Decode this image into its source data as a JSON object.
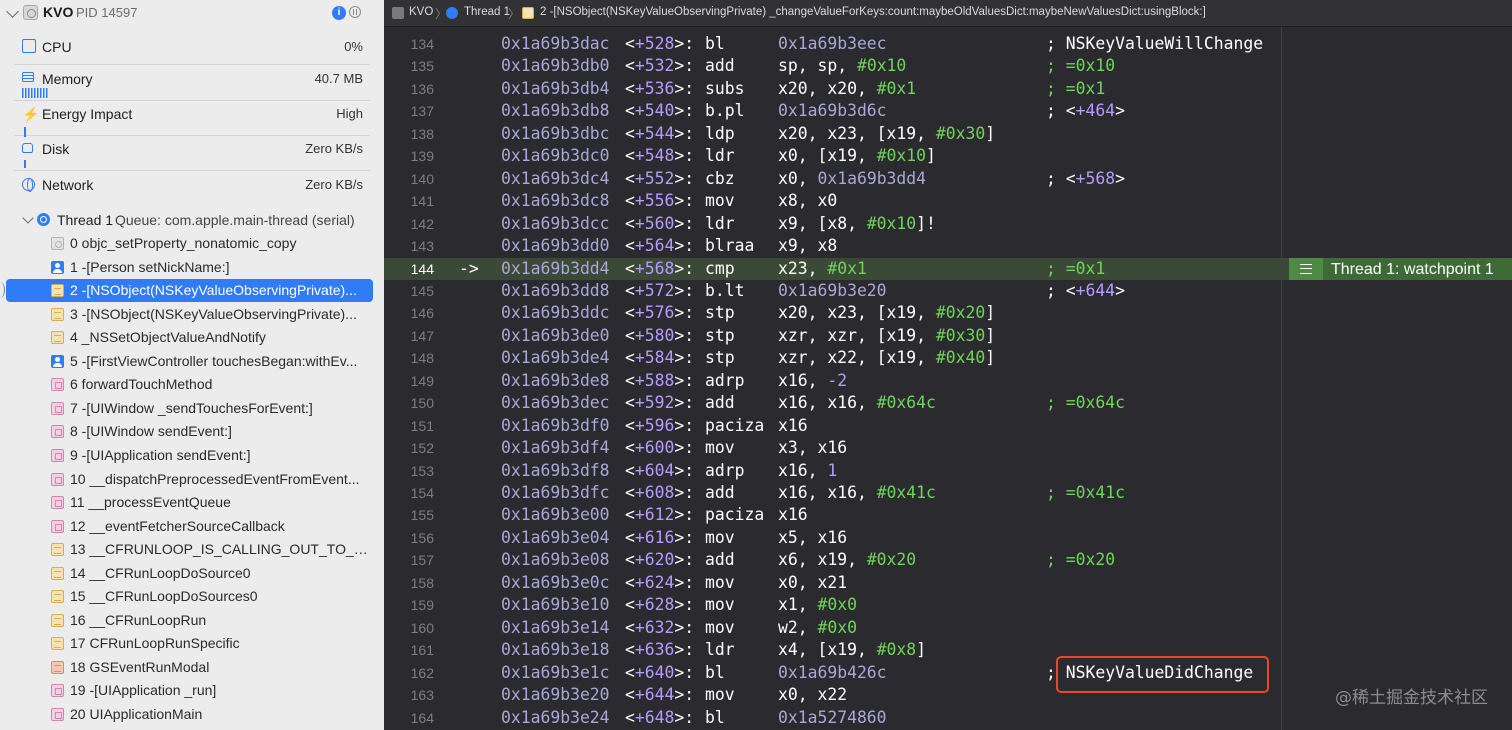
{
  "process": {
    "name": "KVO",
    "pid": "PID 14597"
  },
  "gauges": [
    {
      "label": "CPU",
      "value": "0%",
      "icon": "cpu-icon"
    },
    {
      "label": "Memory",
      "value": "40.7 MB",
      "icon": "memory-icon"
    },
    {
      "label": "Energy Impact",
      "value": "High",
      "icon": "bolt-icon"
    },
    {
      "label": "Disk",
      "value": "Zero KB/s",
      "icon": "disk-icon"
    },
    {
      "label": "Network",
      "value": "Zero KB/s",
      "icon": "globe-icon"
    }
  ],
  "thread": {
    "name": "Thread 1",
    "queue": "Queue: com.apple.main-thread (serial)"
  },
  "frames": [
    {
      "label": "0 objc_setProperty_nonatomic_copy",
      "icon": "gray"
    },
    {
      "label": "1 -[Person setNickName:]",
      "icon": "user"
    },
    {
      "label": "2 -[NSObject(NSKeyValueObservingPrivate)...",
      "icon": "lib",
      "selected": true
    },
    {
      "label": "3 -[NSObject(NSKeyValueObservingPrivate)...",
      "icon": "lib"
    },
    {
      "label": "4 _NSSetObjectValueAndNotify",
      "icon": "lib"
    },
    {
      "label": "5 -[FirstViewController touchesBegan:withEv...",
      "icon": "user"
    },
    {
      "label": "6 forwardTouchMethod",
      "icon": "uikit"
    },
    {
      "label": "7 -[UIWindow _sendTouchesForEvent:]",
      "icon": "uikit"
    },
    {
      "label": "8 -[UIWindow sendEvent:]",
      "icon": "uikit"
    },
    {
      "label": "9 -[UIApplication sendEvent:]",
      "icon": "uikit"
    },
    {
      "label": "10 __dispatchPreprocessedEventFromEvent...",
      "icon": "uikit"
    },
    {
      "label": "11 __processEventQueue",
      "icon": "uikit"
    },
    {
      "label": "12 __eventFetcherSourceCallback",
      "icon": "uikit"
    },
    {
      "label": "13 __CFRUNLOOP_IS_CALLING_OUT_TO_A_...",
      "icon": "lib"
    },
    {
      "label": "14 __CFRunLoopDoSource0",
      "icon": "lib"
    },
    {
      "label": "15 __CFRunLoopDoSources0",
      "icon": "lib"
    },
    {
      "label": "16 __CFRunLoopRun",
      "icon": "lib"
    },
    {
      "label": "17 CFRunLoopRunSpecific",
      "icon": "lib"
    },
    {
      "label": "18 GSEventRunModal",
      "icon": "gs"
    },
    {
      "label": "19 -[UIApplication _run]",
      "icon": "uikit"
    },
    {
      "label": "20 UIApplicationMain",
      "icon": "uikit"
    }
  ],
  "jumpbar": {
    "project": "KVO",
    "thread": "Thread 1",
    "frame": "2 -[NSObject(NSKeyValueObservingPrivate) _changeValueForKeys:count:maybeOldValuesDict:maybeNewValuesDict:usingBlock:]"
  },
  "disassembly": [
    {
      "ln": "134",
      "addr": "0x1a69b3dac",
      "off": "528",
      "mn": "bl",
      "ops": [
        [
          "hexaddr",
          "0x1a69b3eec"
        ]
      ],
      "cmt": "; NSKeyValueWillChange",
      "cmt_style": "white"
    },
    {
      "ln": "135",
      "addr": "0x1a69b3db0",
      "off": "532",
      "mn": "add",
      "ops": [
        [
          "",
          "sp, sp, "
        ],
        [
          "num",
          "#0x10"
        ]
      ],
      "cmt": "; =0x10"
    },
    {
      "ln": "136",
      "addr": "0x1a69b3db4",
      "off": "536",
      "mn": "subs",
      "ops": [
        [
          "",
          "x20, x20, "
        ],
        [
          "num",
          "#0x1"
        ]
      ],
      "cmt": "; =0x1"
    },
    {
      "ln": "137",
      "addr": "0x1a69b3db8",
      "off": "540",
      "mn": "b.pl",
      "ops": [
        [
          "hexaddr",
          "0x1a69b3d6c"
        ]
      ],
      "cmt": "; <+464>",
      "cmt_style": "white"
    },
    {
      "ln": "138",
      "addr": "0x1a69b3dbc",
      "off": "544",
      "mn": "ldp",
      "ops": [
        [
          "",
          "x20, x23, [x19, "
        ],
        [
          "num",
          "#0x30"
        ],
        [
          "",
          "]"
        ]
      ]
    },
    {
      "ln": "139",
      "addr": "0x1a69b3dc0",
      "off": "548",
      "mn": "ldr",
      "ops": [
        [
          "",
          "x0, [x19, "
        ],
        [
          "num",
          "#0x10"
        ],
        [
          "",
          "]"
        ]
      ]
    },
    {
      "ln": "140",
      "addr": "0x1a69b3dc4",
      "off": "552",
      "mn": "cbz",
      "ops": [
        [
          "",
          "x0, "
        ],
        [
          "hexaddr",
          "0x1a69b3dd4"
        ]
      ],
      "cmt": "; <+568>",
      "cmt_style": "white"
    },
    {
      "ln": "141",
      "addr": "0x1a69b3dc8",
      "off": "556",
      "mn": "mov",
      "ops": [
        [
          "",
          "x8, x0"
        ]
      ]
    },
    {
      "ln": "142",
      "addr": "0x1a69b3dcc",
      "off": "560",
      "mn": "ldr",
      "ops": [
        [
          "",
          "x9, [x8, "
        ],
        [
          "num",
          "#0x10"
        ],
        [
          "",
          "]!"
        ]
      ]
    },
    {
      "ln": "143",
      "addr": "0x1a69b3dd0",
      "off": "564",
      "mn": "blraa",
      "ops": [
        [
          "",
          "x9, x8"
        ]
      ]
    },
    {
      "ln": "144",
      "addr": "0x1a69b3dd4",
      "off": "568",
      "mn": "cmp",
      "ops": [
        [
          "",
          "x23, "
        ],
        [
          "num",
          "#0x1"
        ]
      ],
      "cmt": "; =0x1",
      "current": true,
      "arrow": "->"
    },
    {
      "ln": "145",
      "addr": "0x1a69b3dd8",
      "off": "572",
      "mn": "b.lt",
      "ops": [
        [
          "hexaddr",
          "0x1a69b3e20"
        ]
      ],
      "cmt": "; <+644>",
      "cmt_style": "white"
    },
    {
      "ln": "146",
      "addr": "0x1a69b3ddc",
      "off": "576",
      "mn": "stp",
      "ops": [
        [
          "",
          "x20, x23, [x19, "
        ],
        [
          "num",
          "#0x20"
        ],
        [
          "",
          "]"
        ]
      ]
    },
    {
      "ln": "147",
      "addr": "0x1a69b3de0",
      "off": "580",
      "mn": "stp",
      "ops": [
        [
          "",
          "xzr, xzr, [x19, "
        ],
        [
          "num",
          "#0x30"
        ],
        [
          "",
          "]"
        ]
      ]
    },
    {
      "ln": "148",
      "addr": "0x1a69b3de4",
      "off": "584",
      "mn": "stp",
      "ops": [
        [
          "",
          "xzr, x22, [x19, "
        ],
        [
          "num",
          "#0x40"
        ],
        [
          "",
          "]"
        ]
      ]
    },
    {
      "ln": "149",
      "addr": "0x1a69b3de8",
      "off": "588",
      "mn": "adrp",
      "ops": [
        [
          "",
          "x16, "
        ],
        [
          "neg",
          "-2"
        ]
      ]
    },
    {
      "ln": "150",
      "addr": "0x1a69b3dec",
      "off": "592",
      "mn": "add",
      "ops": [
        [
          "",
          "x16, x16, "
        ],
        [
          "num",
          "#0x64c"
        ]
      ],
      "cmt": "; =0x64c"
    },
    {
      "ln": "151",
      "addr": "0x1a69b3df0",
      "off": "596",
      "mn": "paciza",
      "ops": [
        [
          "",
          "x16"
        ]
      ]
    },
    {
      "ln": "152",
      "addr": "0x1a69b3df4",
      "off": "600",
      "mn": "mov",
      "ops": [
        [
          "",
          "x3, x16"
        ]
      ]
    },
    {
      "ln": "153",
      "addr": "0x1a69b3df8",
      "off": "604",
      "mn": "adrp",
      "ops": [
        [
          "",
          "x16, "
        ],
        [
          "neg",
          "1"
        ]
      ]
    },
    {
      "ln": "154",
      "addr": "0x1a69b3dfc",
      "off": "608",
      "mn": "add",
      "ops": [
        [
          "",
          "x16, x16, "
        ],
        [
          "num",
          "#0x41c"
        ]
      ],
      "cmt": "; =0x41c"
    },
    {
      "ln": "155",
      "addr": "0x1a69b3e00",
      "off": "612",
      "mn": "paciza",
      "ops": [
        [
          "",
          "x16"
        ]
      ]
    },
    {
      "ln": "156",
      "addr": "0x1a69b3e04",
      "off": "616",
      "mn": "mov",
      "ops": [
        [
          "",
          "x5, x16"
        ]
      ]
    },
    {
      "ln": "157",
      "addr": "0x1a69b3e08",
      "off": "620",
      "mn": "add",
      "ops": [
        [
          "",
          "x6, x19, "
        ],
        [
          "num",
          "#0x20"
        ]
      ],
      "cmt": "; =0x20"
    },
    {
      "ln": "158",
      "addr": "0x1a69b3e0c",
      "off": "624",
      "mn": "mov",
      "ops": [
        [
          "",
          "x0, x21"
        ]
      ]
    },
    {
      "ln": "159",
      "addr": "0x1a69b3e10",
      "off": "628",
      "mn": "mov",
      "ops": [
        [
          "",
          "x1, "
        ],
        [
          "num",
          "#0x0"
        ]
      ]
    },
    {
      "ln": "160",
      "addr": "0x1a69b3e14",
      "off": "632",
      "mn": "mov",
      "ops": [
        [
          "",
          "w2, "
        ],
        [
          "num",
          "#0x0"
        ]
      ]
    },
    {
      "ln": "161",
      "addr": "0x1a69b3e18",
      "off": "636",
      "mn": "ldr",
      "ops": [
        [
          "",
          "x4, [x19, "
        ],
        [
          "num",
          "#0x8"
        ],
        [
          "",
          "]"
        ]
      ]
    },
    {
      "ln": "162",
      "addr": "0x1a69b3e1c",
      "off": "640",
      "mn": "bl",
      "ops": [
        [
          "hexaddr",
          "0x1a69b426c"
        ]
      ],
      "cmt": "; NSKeyValueDidChange",
      "cmt_style": "white"
    },
    {
      "ln": "163",
      "addr": "0x1a69b3e20",
      "off": "644",
      "mn": "mov",
      "ops": [
        [
          "",
          "x0, x22"
        ]
      ]
    },
    {
      "ln": "164",
      "addr": "0x1a69b3e24",
      "off": "648",
      "mn": "bl",
      "ops": [
        [
          "hexaddr",
          "0x1a5274860"
        ]
      ]
    }
  ],
  "watchpoint_badge": "Thread 1: watchpoint 1",
  "watermark": "@稀土掘金技术社区",
  "colors": {
    "accent": "#2f7cf6",
    "current_line": "#3a4a36",
    "badge": "#3e6a36",
    "highlight": "#e8491f"
  }
}
